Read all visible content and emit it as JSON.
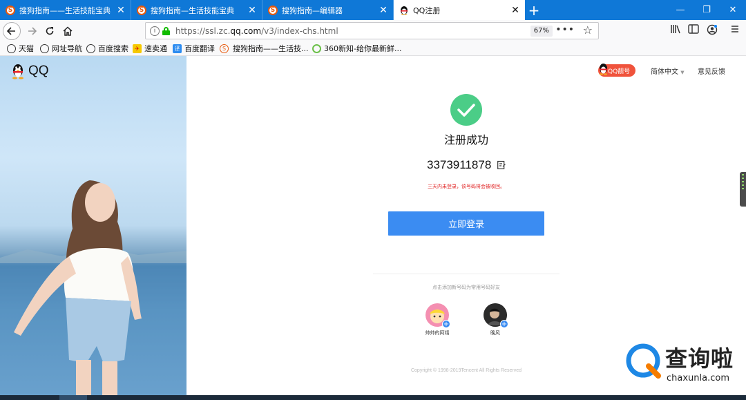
{
  "browser": {
    "tabs": [
      {
        "title": "搜狗指南——生活技能宝典",
        "icon": "sogou-icon",
        "active": false
      },
      {
        "title": "搜狗指南—生活技能宝典",
        "icon": "sogou-icon",
        "active": false
      },
      {
        "title": "搜狗指南—编辑器",
        "icon": "sogou-icon",
        "active": false
      },
      {
        "title": "QQ注册",
        "icon": "qq-penguin-icon",
        "active": true
      }
    ],
    "new_tab": "+",
    "window_controls": {
      "minimize": "—",
      "restore": "❐",
      "close": "✕"
    },
    "url": {
      "prefix": "https://ssl.zc.",
      "host": "qq.com",
      "path": "/v3/index-chs.html"
    },
    "zoom": "67%",
    "bookmarks": [
      {
        "label": "天猫",
        "icon": "globe-icon"
      },
      {
        "label": "网址导航",
        "icon": "globe-icon"
      },
      {
        "label": "百度搜索",
        "icon": "globe-icon"
      },
      {
        "label": "速卖通",
        "icon": "aliexpress-icon"
      },
      {
        "label": "百度翻译",
        "icon": "translate-icon"
      },
      {
        "label": "搜狗指南——生活技...",
        "icon": "sogou-icon"
      },
      {
        "label": "360新知-给你最新鲜...",
        "icon": "360-icon"
      }
    ]
  },
  "page": {
    "logo_text": "QQ",
    "qq_badge": "QQ靓号",
    "language": "简体中文",
    "feedback": "意见反馈",
    "success_title": "注册成功",
    "qq_number": "3373911878",
    "warning": "三天内未登录，该号码将会被收回。",
    "login_button": "立即登录",
    "add_friend_tip": "点击添加新号码为常用号码好友",
    "friends": [
      {
        "name": "帅帅的阿靖"
      },
      {
        "name": "晚风"
      }
    ],
    "copyright": "Copyright © 1998-2019Tencent All Rights Reserved"
  },
  "watermark": {
    "cn": "查询啦",
    "en": "chaxunla.com"
  },
  "colors": {
    "tabbar": "#0f78d7",
    "success_green": "#4bcd87",
    "login_blue": "#3b8cf2",
    "warning_red": "#e02020",
    "badge_red": "#f0533c"
  }
}
